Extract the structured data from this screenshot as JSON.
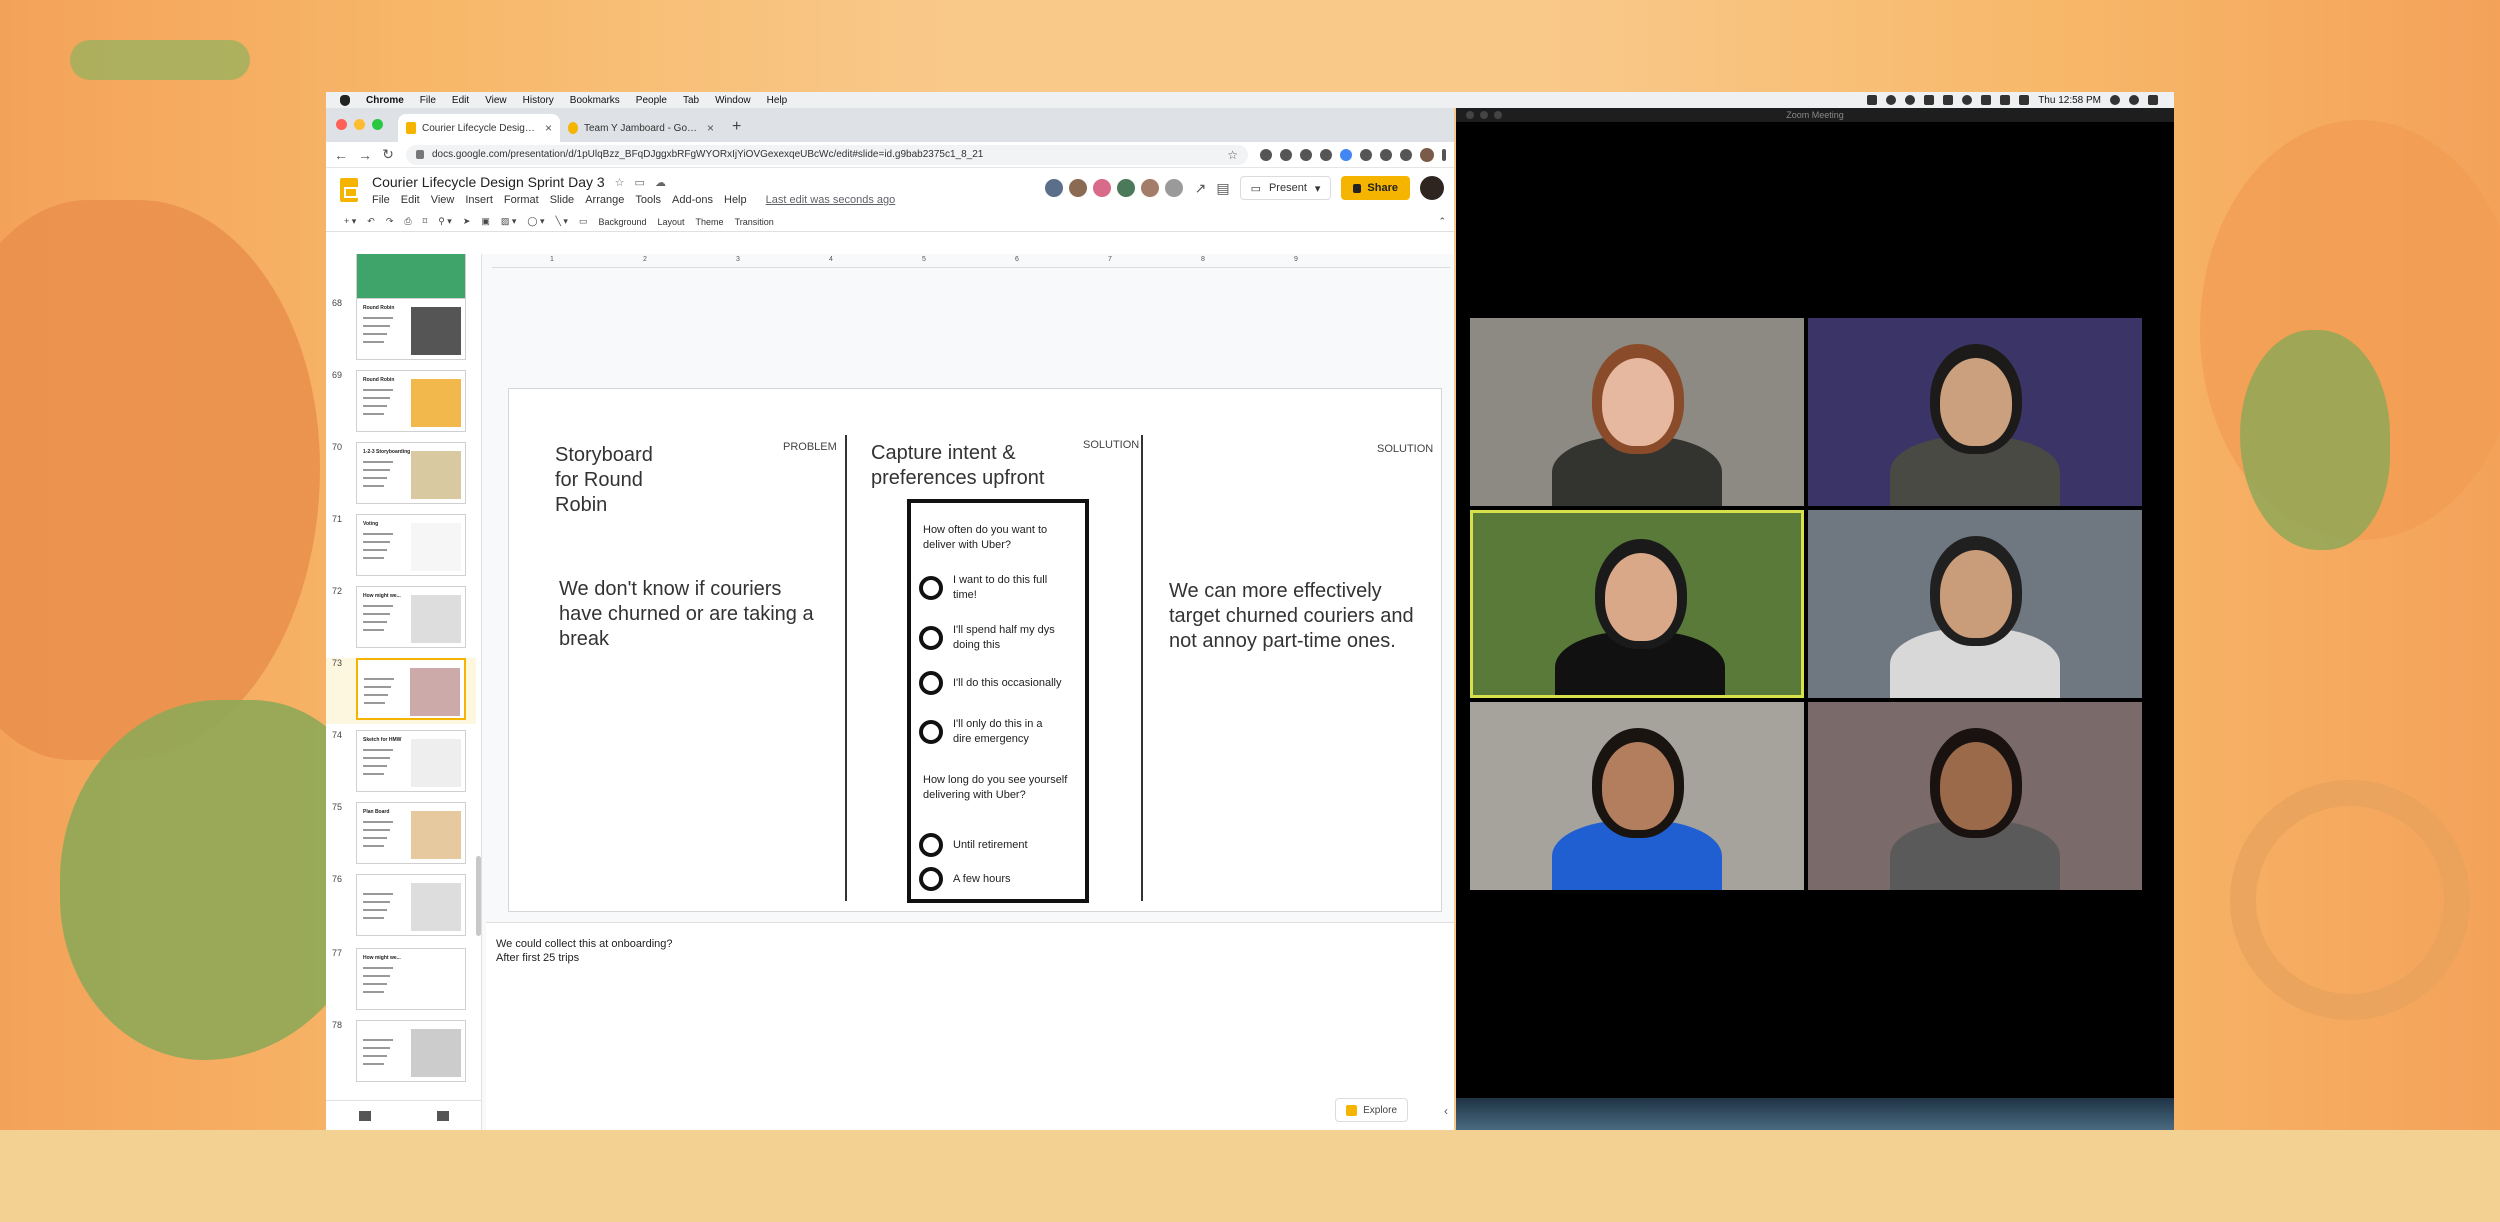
{
  "menubar": {
    "items": [
      "Chrome",
      "File",
      "Edit",
      "View",
      "History",
      "Bookmarks",
      "People",
      "Tab",
      "Window",
      "Help"
    ],
    "clock": "Thu 12:58 PM"
  },
  "browser": {
    "tabs": [
      {
        "title": "Courier Lifecycle Design Sprint D",
        "active": true
      },
      {
        "title": "Team Y Jamboard - Google Ja",
        "active": false
      }
    ],
    "url": "docs.google.com/presentation/d/1pUlqBzz_BFqDJggxbRFgWYORxIjYiOVGexexqeUBcWc/edit#slide=id.g9bab2375c1_8_21"
  },
  "slides_app": {
    "title": "Courier Lifecycle Design Sprint Day 3",
    "menus": [
      "File",
      "Edit",
      "View",
      "Insert",
      "Format",
      "Slide",
      "Arrange",
      "Tools",
      "Add-ons",
      "Help"
    ],
    "last_edit": "Last edit was seconds ago",
    "present_label": "Present",
    "share_label": "Share",
    "toolbar": [
      "Background",
      "Layout",
      "Theme",
      "Transition"
    ],
    "collaborator_colors": [
      "#5b6f8a",
      "#8a6a52",
      "#d86a8a",
      "#4a7a5a",
      "#a47c6a",
      "#9a9a9a"
    ],
    "accent": "#f4b400"
  },
  "filmstrip": {
    "slides": [
      {
        "num": "",
        "title": "",
        "color": "#3fa46a"
      },
      {
        "num": "68",
        "title": "Round Robin",
        "color": "#ffffff"
      },
      {
        "num": "69",
        "title": "Round Robin",
        "color": "#ffffff"
      },
      {
        "num": "70",
        "title": "1-2-3 Storyboarding",
        "color": "#ffffff"
      },
      {
        "num": "71",
        "title": "Voting",
        "color": "#ffffff"
      },
      {
        "num": "72",
        "title": "How might we...",
        "color": "#ffffff"
      },
      {
        "num": "73",
        "title": "",
        "color": "#ffffff"
      },
      {
        "num": "74",
        "title": "Sketch for HMW",
        "color": "#ffffff"
      },
      {
        "num": "75",
        "title": "Plan Board",
        "color": "#ffffff"
      },
      {
        "num": "76",
        "title": "",
        "color": "#ffffff"
      },
      {
        "num": "77",
        "title": "How might we...",
        "color": "#ffffff"
      },
      {
        "num": "78",
        "title": "",
        "color": "#ffffff"
      }
    ],
    "selected": "73"
  },
  "ruler": [
    "1",
    "2",
    "3",
    "4",
    "5",
    "6",
    "7",
    "8",
    "9"
  ],
  "slide": {
    "storyboard_title": "Storyboard for Round Robin",
    "problem_label": "PROBLEM",
    "problem_text": "We don't know if couriers have churned or are taking a break",
    "middle_title": "Capture intent & preferences upfront",
    "solution_label_1": "SOLUTION",
    "solution_label_2": "SOLUTION",
    "solution_text": "We can more effectively target churned couriers and not annoy part-time ones.",
    "phone": {
      "q1": "How often do you want to deliver with Uber?",
      "options1": [
        "I want to do this full time!",
        "I'll spend half my dys doing this",
        "I'll do this occasionally",
        "I'll only do this in a dire emergency"
      ],
      "q2": "How long do you see yourself delivering with Uber?",
      "options2": [
        "Until retirement",
        "A few hours"
      ]
    }
  },
  "notes": {
    "line1": "We could collect this at onboarding?",
    "line2": "After first 25 trips",
    "explore_label": "Explore"
  },
  "zoom": {
    "title": "Zoom Meeting",
    "participants": [
      {
        "bg": "#8d8a84",
        "skin": "#e6b8a0",
        "hair": "#8a4b2a",
        "shirt": "#33342f",
        "active": false
      },
      {
        "bg": "#3a3566",
        "skin": "#caa07e",
        "hair": "#1d1a1a",
        "shirt": "#4a4a44",
        "active": false
      },
      {
        "bg": "#5a7a3a",
        "skin": "#d8a888",
        "hair": "#1a1a1a",
        "shirt": "#111111",
        "active": true
      },
      {
        "bg": "#6f7780",
        "skin": "#c99c7a",
        "hair": "#202020",
        "shirt": "#d8d8d8",
        "active": false
      },
      {
        "bg": "#a6a39c",
        "skin": "#b27e5e",
        "hair": "#1a1410",
        "shirt": "#1f5fd1",
        "active": false
      },
      {
        "bg": "#7a6a6a",
        "skin": "#9a6a4a",
        "hair": "#1a1210",
        "shirt": "#5a5a5a",
        "active": false
      }
    ]
  }
}
